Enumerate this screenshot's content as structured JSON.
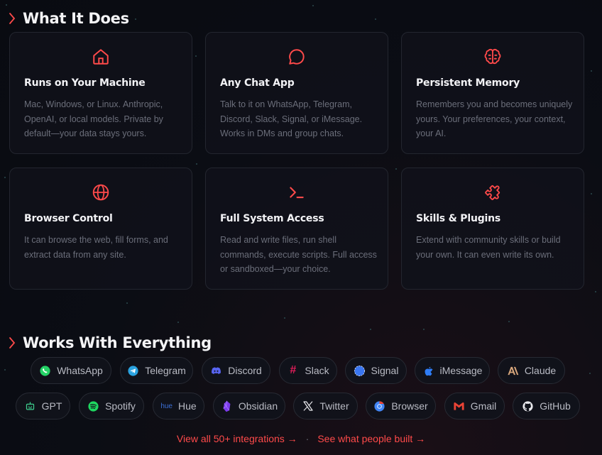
{
  "features": {
    "title": "What It Does",
    "cards": [
      {
        "title": "Runs on Your Machine",
        "desc": "Mac, Windows, or Linux. Anthropic, OpenAI, or local models. Private by default—your data stays yours.",
        "icon": "home-icon"
      },
      {
        "title": "Any Chat App",
        "desc": "Talk to it on WhatsApp, Telegram, Discord, Slack, Signal, or iMessage. Works in DMs and group chats.",
        "icon": "chat-bubble-icon"
      },
      {
        "title": "Persistent Memory",
        "desc": "Remembers you and becomes uniquely yours. Your preferences, your context, your AI.",
        "icon": "brain-icon"
      },
      {
        "title": "Browser Control",
        "desc": "It can browse the web, fill forms, and extract data from any site.",
        "icon": "globe-icon"
      },
      {
        "title": "Full System Access",
        "desc": "Read and write files, run shell commands, execute scripts. Full access or sandboxed—your choice.",
        "icon": "terminal-icon"
      },
      {
        "title": "Skills & Plugins",
        "desc": "Extend with community skills or build your own. It can even write its own.",
        "icon": "puzzle-icon"
      }
    ]
  },
  "integrations": {
    "title": "Works With Everything",
    "chips": [
      {
        "label": "WhatsApp",
        "icon": "whatsapp-icon"
      },
      {
        "label": "Telegram",
        "icon": "telegram-icon"
      },
      {
        "label": "Discord",
        "icon": "discord-icon"
      },
      {
        "label": "Slack",
        "icon": "slack-icon"
      },
      {
        "label": "Signal",
        "icon": "signal-icon"
      },
      {
        "label": "iMessage",
        "icon": "apple-icon"
      },
      {
        "label": "Claude",
        "icon": "claude-icon"
      },
      {
        "label": "GPT",
        "icon": "gpt-icon"
      },
      {
        "label": "Spotify",
        "icon": "spotify-icon"
      },
      {
        "label": "Hue",
        "icon": "hue-icon",
        "icon_text": "hue"
      },
      {
        "label": "Obsidian",
        "icon": "obsidian-icon"
      },
      {
        "label": "Twitter",
        "icon": "x-icon"
      },
      {
        "label": "Browser",
        "icon": "chrome-icon"
      },
      {
        "label": "Gmail",
        "icon": "gmail-icon"
      },
      {
        "label": "GitHub",
        "icon": "github-icon"
      }
    ],
    "link_all": "View all 50+ integrations →",
    "link_separator": "·",
    "link_showcase": "See what people built →"
  },
  "colors": {
    "accent": "#ff4a4a",
    "background": "#0b0d14",
    "card_border": "#23262f"
  }
}
